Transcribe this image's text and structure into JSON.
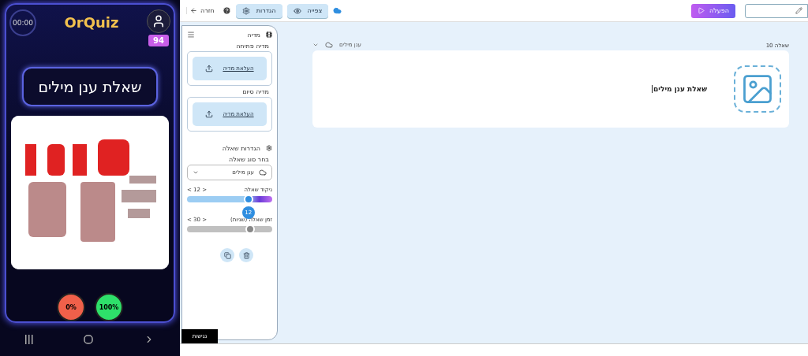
{
  "phone": {
    "timer": "00:00",
    "logo": "OrQuiz",
    "score": "94",
    "question": "שאלת ענן מילים",
    "answers": [
      {
        "label": "100%",
        "color": "#2ee06a"
      },
      {
        "label": "0%",
        "color": "#f0604a"
      }
    ]
  },
  "toolbar": {
    "back": "חזרה",
    "settings": "הגדרות",
    "preview": "צפייה",
    "activate": "הפעלה"
  },
  "sidebar": {
    "media_title": "מדיה",
    "opening_label": "מדיה פתיחה",
    "opening_button": "העלאת מדיה",
    "closing_label": "מדיה סיום",
    "closing_button": "העלאת מדיה",
    "settings_title": "הגדרות שאלה",
    "type_label": "בחר סוג שאלה",
    "type_value": "ענן מילים",
    "sliders": [
      {
        "label": "ניקוד שאלה",
        "reading": "< 12 >",
        "level": 0.72,
        "bubble": "12",
        "kind": "accent"
      },
      {
        "label": "זמן שאלה (שניות)",
        "reading": "< 30 >",
        "level": 0.74,
        "kind": "plain"
      }
    ],
    "accessibility": "נגישות"
  },
  "main": {
    "type": "ענן מילים",
    "question_number": "שאלה 10",
    "question_text": "שאלת ענן מילים"
  }
}
